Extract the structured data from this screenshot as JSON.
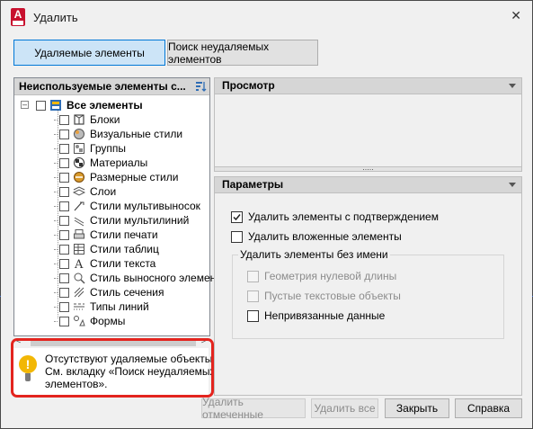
{
  "window": {
    "title": "Удалить",
    "app_icon_letter": "A"
  },
  "tabs": [
    {
      "label": "Удаляемые элементы",
      "active": true
    },
    {
      "label": "Поиск неудаляемых элементов",
      "active": false
    }
  ],
  "left_panel": {
    "header": "Неиспользуемые элементы с...",
    "root": {
      "label": "Все элементы"
    },
    "items": [
      {
        "label": "Блоки",
        "icon": "blocks-icon"
      },
      {
        "label": "Визуальные стили",
        "icon": "visual-styles-icon"
      },
      {
        "label": "Группы",
        "icon": "groups-icon"
      },
      {
        "label": "Материалы",
        "icon": "materials-icon"
      },
      {
        "label": "Размерные стили",
        "icon": "dimension-styles-icon"
      },
      {
        "label": "Слои",
        "icon": "layers-icon"
      },
      {
        "label": "Стили мультивыносок",
        "icon": "multileader-styles-icon"
      },
      {
        "label": "Стили мультилиний",
        "icon": "mline-styles-icon"
      },
      {
        "label": "Стили печати",
        "icon": "plot-styles-icon"
      },
      {
        "label": "Стили таблиц",
        "icon": "table-styles-icon"
      },
      {
        "label": "Стили текста",
        "icon": "text-styles-icon"
      },
      {
        "label": "Стиль выносного элемента",
        "icon": "detail-view-style-icon"
      },
      {
        "label": "Стиль сечения",
        "icon": "section-view-style-icon"
      },
      {
        "label": "Типы линий",
        "icon": "linetypes-icon"
      },
      {
        "label": "Формы",
        "icon": "shapes-icon"
      }
    ]
  },
  "info": {
    "lines": [
      "Отсутствуют удаляемые объекты.",
      "См. вкладку «Поиск неудаляемых",
      "элементов»."
    ]
  },
  "preview": {
    "header": "Просмотр"
  },
  "params": {
    "header": "Параметры",
    "confirm_label": "Удалить элементы с подтверждением",
    "confirm_checked": true,
    "nested_label": "Удалить вложенные элементы",
    "nested_checked": false,
    "group_label": "Удалить элементы без имени",
    "zero_length_label": "Геометрия нулевой длины",
    "empty_text_label": "Пустые текстовые объекты",
    "orphan_data_label": "Непривязанные данные"
  },
  "buttons": {
    "purge_checked": "Удалить отмеченные",
    "purge_all": "Удалить все",
    "close": "Закрыть",
    "help": "Справка"
  },
  "colors": {
    "accent": "#0078d7",
    "highlight_frame": "#e3241e",
    "warning": "#f2b705"
  }
}
